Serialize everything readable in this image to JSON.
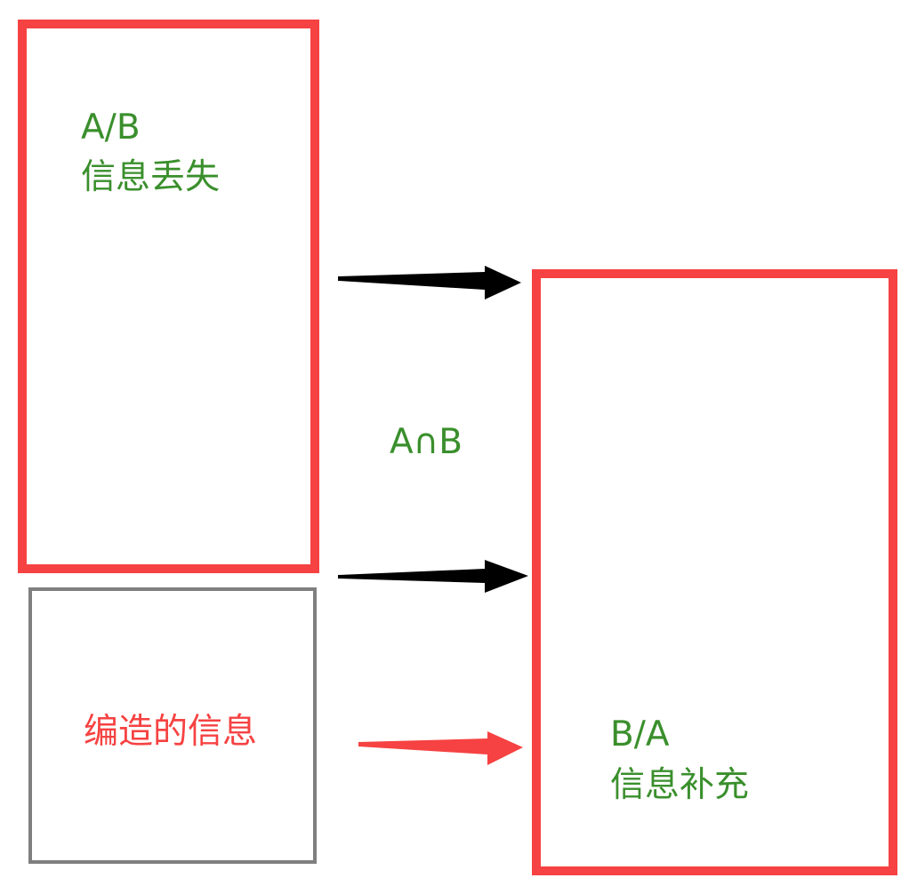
{
  "left_box": {
    "line1": "A/B",
    "line2": "信息丢失"
  },
  "intersection_label": "A∩B",
  "fabricated_box": {
    "text": "编造的信息"
  },
  "right_box": {
    "line1": "B/A",
    "line2": "信息补充"
  },
  "colors": {
    "box_red": "#f64242",
    "box_gray": "#7f7f7f",
    "text_green": "#3a8f2c",
    "text_red": "#f64242",
    "arrow_black": "#000000",
    "arrow_red": "#f64242"
  },
  "arrows": [
    {
      "name": "arrow-top",
      "color": "black"
    },
    {
      "name": "arrow-middle",
      "color": "black"
    },
    {
      "name": "arrow-fabricated",
      "color": "red"
    }
  ]
}
